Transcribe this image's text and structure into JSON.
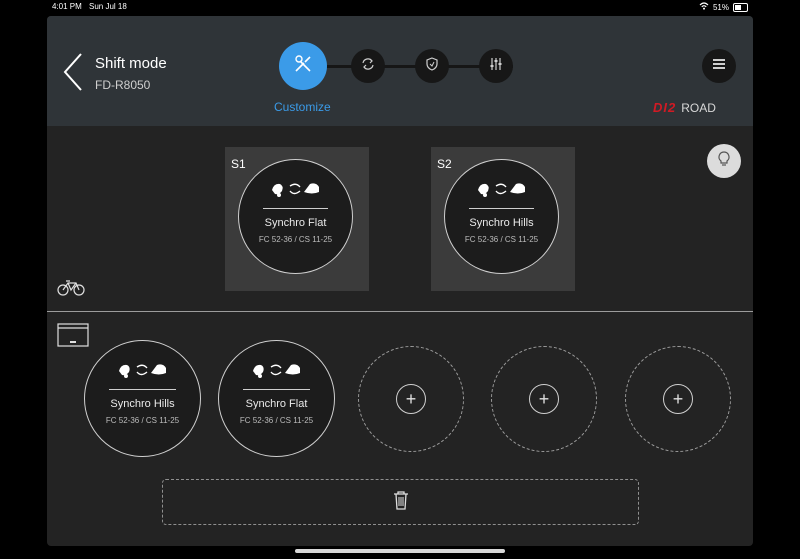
{
  "status_bar": {
    "time": "4:01 PM",
    "date": "Sun Jul 18",
    "battery": "51%"
  },
  "header": {
    "title": "Shift mode",
    "subtitle": "FD-R8050",
    "active_step_label": "Customize",
    "brand_logo": "DI2",
    "brand_text": "ROAD",
    "steps": [
      {
        "icon": "tools-icon",
        "active": true
      },
      {
        "icon": "sync-icon",
        "active": false
      },
      {
        "icon": "shield-icon",
        "active": false
      },
      {
        "icon": "sliders-icon",
        "active": false
      }
    ]
  },
  "bike_slots": [
    {
      "tag": "S1",
      "name": "Synchro Flat",
      "spec": "FC 52-36 / CS 11-25"
    },
    {
      "tag": "S2",
      "name": "Synchro Hills",
      "spec": "FC 52-36 / CS 11-25"
    }
  ],
  "library": [
    {
      "name": "Synchro Hills",
      "spec": "FC 52-36 / CS 11-25"
    },
    {
      "name": "Synchro Flat",
      "spec": "FC 52-36 / CS 11-25"
    }
  ],
  "icons": {
    "bike": "bicycle-icon",
    "device": "device-icon",
    "bulb": "lightbulb-icon",
    "trash": "trash-icon",
    "mode_glyph": "shift-mode-icon"
  },
  "colors": {
    "accent": "#3b9be8",
    "brand_red": "#d11a24"
  }
}
